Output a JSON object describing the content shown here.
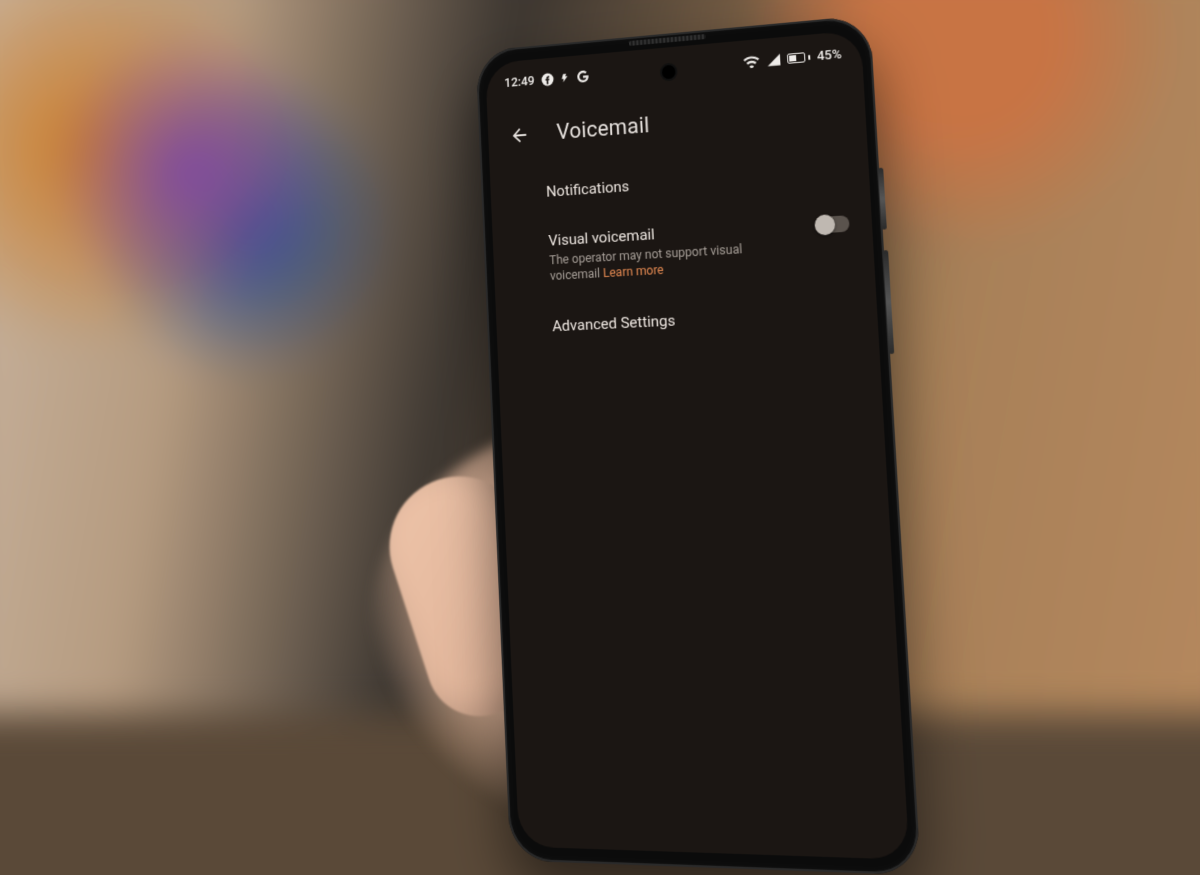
{
  "statusbar": {
    "time": "12:49",
    "battery_percent": "45%",
    "icons_left": [
      "facebook",
      "bolt",
      "google"
    ],
    "icons_right": [
      "wifi",
      "signal",
      "battery"
    ]
  },
  "header": {
    "title": "Voicemail"
  },
  "list": {
    "notifications": {
      "title": "Notifications"
    },
    "visual_voicemail": {
      "title": "Visual voicemail",
      "subtitle_prefix": "The operator may not support visual voicemail ",
      "learn_more": "Learn more",
      "toggle": false
    },
    "advanced": {
      "title": "Advanced Settings"
    }
  },
  "colors": {
    "screen_bg": "#1b1613",
    "text": "#e6e1dd",
    "subtext": "#a79f98",
    "accent": "#e58a52"
  }
}
